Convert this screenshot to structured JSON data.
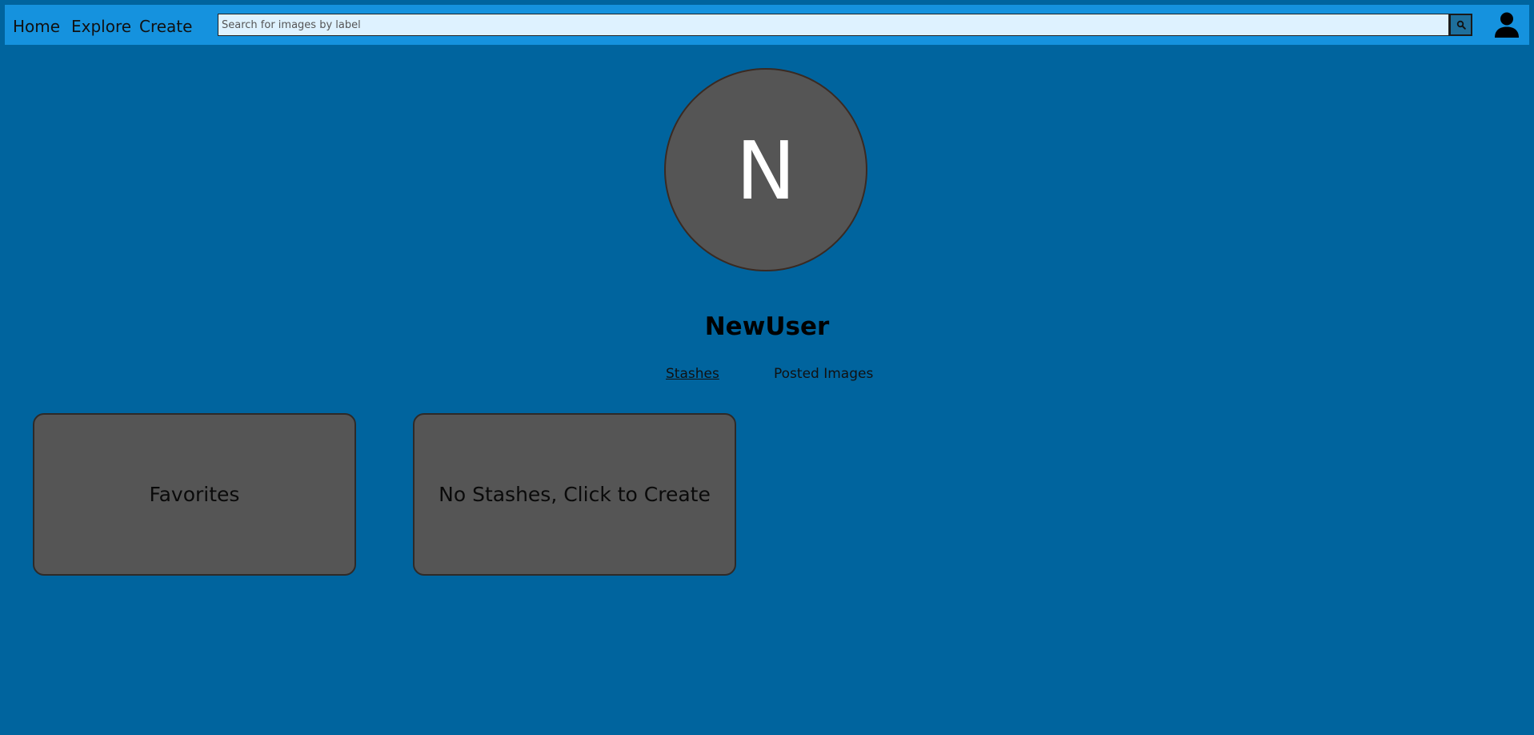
{
  "nav": {
    "home": "Home",
    "explore": "Explore",
    "create": "Create"
  },
  "search": {
    "placeholder": "Search for images by label",
    "value": "",
    "button_icon": "search-icon"
  },
  "account": {
    "icon": "user-account-icon"
  },
  "profile": {
    "avatar_letter": "N",
    "username": "NewUser"
  },
  "tabs": [
    {
      "label": "Stashes",
      "active": true
    },
    {
      "label": "Posted Images",
      "active": false
    }
  ],
  "cards": [
    {
      "label": "Favorites"
    },
    {
      "label": "No Stashes, Click to Create"
    }
  ],
  "colors": {
    "page_background": "#00649e",
    "navbar_background": "#1592de",
    "search_background": "#def2ff",
    "avatar_background": "#555555",
    "card_background": "#555555"
  }
}
